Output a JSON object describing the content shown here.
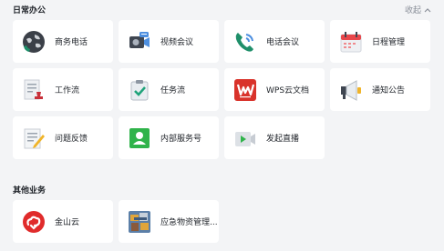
{
  "sections": {
    "office": {
      "title": "日常办公",
      "collapse_label": "收起",
      "apps": [
        {
          "label": "商务电话",
          "icon": "globe-phone-icon"
        },
        {
          "label": "视频会议",
          "icon": "video-camera-icon"
        },
        {
          "label": "电话会议",
          "icon": "phone-icon"
        },
        {
          "label": "日程管理",
          "icon": "calendar-icon"
        },
        {
          "label": "工作流",
          "icon": "document-stamp-icon"
        },
        {
          "label": "任务流",
          "icon": "clipboard-check-icon"
        },
        {
          "label": "WPS云文档",
          "icon": "wps-logo-icon"
        },
        {
          "label": "通知公告",
          "icon": "megaphone-icon"
        },
        {
          "label": "问题反馈",
          "icon": "notepad-pencil-icon"
        },
        {
          "label": "内部服务号",
          "icon": "user-badge-icon"
        },
        {
          "label": "发起直播",
          "icon": "live-video-icon"
        }
      ]
    },
    "other": {
      "title": "其他业务",
      "apps": [
        {
          "label": "金山云",
          "icon": "kingsoft-cloud-icon"
        },
        {
          "label": "应急物资管理...",
          "icon": "emergency-supplies-icon"
        }
      ]
    }
  },
  "colors": {
    "background": "#f3f4f6",
    "card": "#ffffff",
    "wps_red": "#d9332b",
    "cloud_red": "#e02b2b",
    "green": "#2fb34a",
    "phone_green": "#1f8f6a"
  },
  "icons": {
    "collapse": "chevron-up-icon"
  }
}
